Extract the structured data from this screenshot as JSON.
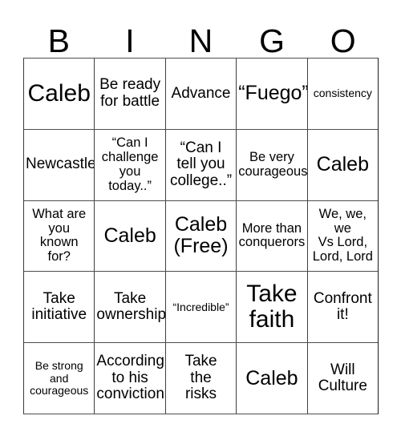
{
  "card": {
    "header_letters": [
      "B",
      "I",
      "N",
      "G",
      "O"
    ],
    "columns": 5,
    "rows": 5,
    "free_space": "Caleb\n(Free)",
    "colors": {
      "background": "#ffffff",
      "text": "#000000",
      "grid_line": "#3f3f3f"
    },
    "rows_data": [
      {
        "cells": [
          {
            "text": "Caleb",
            "size": "xl"
          },
          {
            "text": "Be ready\nfor battle",
            "size": "md"
          },
          {
            "text": "Advance",
            "size": "md"
          },
          {
            "text": "“Fuego”",
            "size": "lg"
          },
          {
            "text": "consistency",
            "size": "xs"
          }
        ]
      },
      {
        "cells": [
          {
            "text": "Newcastle",
            "size": "md"
          },
          {
            "text": "“Can I\nchallenge\nyou\ntoday..”",
            "size": "sm"
          },
          {
            "text": "“Can I\ntell you\ncollege..”",
            "size": "md"
          },
          {
            "text": "Be very\ncourageous",
            "size": "sm"
          },
          {
            "text": "Caleb",
            "size": "lg"
          }
        ]
      },
      {
        "cells": [
          {
            "text": "What are\nyou\nknown\nfor?",
            "size": "sm"
          },
          {
            "text": "Caleb",
            "size": "lg"
          },
          {
            "text": "Caleb\n(Free)",
            "size": "lg"
          },
          {
            "text": "More than\nconquerors",
            "size": "sm"
          },
          {
            "text": "We, we,\nwe\nVs Lord,\nLord, Lord",
            "size": "sm"
          }
        ]
      },
      {
        "cells": [
          {
            "text": "Take\ninitiative",
            "size": "md"
          },
          {
            "text": "Take\nownership",
            "size": "md"
          },
          {
            "text": "“Incredible”",
            "size": "xs"
          },
          {
            "text": "Take\nfaith",
            "size": "xl"
          },
          {
            "text": "Confront\nit!",
            "size": "md"
          }
        ]
      },
      {
        "cells": [
          {
            "text": "Be strong\nand\ncourageous",
            "size": "xs"
          },
          {
            "text": "According\nto his\nconviction",
            "size": "md"
          },
          {
            "text": "Take\nthe\nrisks",
            "size": "md"
          },
          {
            "text": "Caleb",
            "size": "lg"
          },
          {
            "text": "Will\nCulture",
            "size": "md"
          }
        ]
      }
    ]
  }
}
